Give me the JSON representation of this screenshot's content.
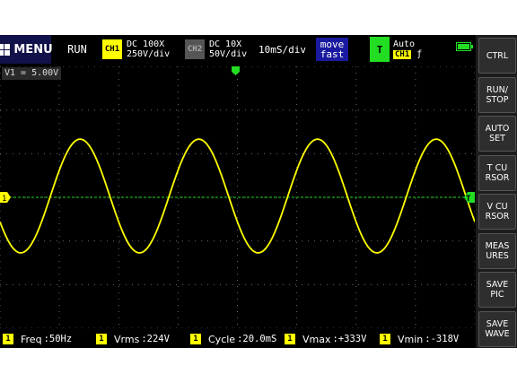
{
  "topbar": {
    "menu_label": "MENU",
    "run_status": "RUN",
    "ch1": {
      "badge": "CH1",
      "line1": "DC 100X",
      "line2": "250V/div"
    },
    "ch2": {
      "badge": "CH2",
      "line1": "DC 10X",
      "line2": "50V/div"
    },
    "timebase": "10mS/div",
    "move_mode": {
      "line1": "move",
      "line2": "fast"
    },
    "trigger": {
      "badge": "T",
      "mode": "Auto",
      "channel": "CH1",
      "edge": "ƒ"
    },
    "battery_level": 1.0
  },
  "screen": {
    "v1_readout": "V1 = 5.00V",
    "ch1_marker": "1",
    "trigger_marker": "T",
    "waveform": {
      "frequency_hz": 50,
      "vmax": 333,
      "vmin": -318,
      "color": "#ffff00"
    },
    "trigger_level_color": "#22dd22"
  },
  "side_buttons": [
    "CTRL",
    "RUN/\nSTOP",
    "AUTO\nSET",
    "T CU\nRSOR",
    "V CU\nRSOR",
    "MEAS\nURES",
    "SAVE\nPIC",
    "SAVE\nWAVE"
  ],
  "measures": [
    {
      "num": "1",
      "label": "Freq",
      "value": ":50Hz"
    },
    {
      "num": "1",
      "label": "Vrms",
      "value": ":224V"
    },
    {
      "num": "1",
      "label": "Cycle",
      "value": ":20.0mS"
    },
    {
      "num": "1",
      "label": "Vmax",
      "value": ":+333V"
    },
    {
      "num": "1",
      "label": "Vmin",
      "value": ":-318V"
    }
  ]
}
